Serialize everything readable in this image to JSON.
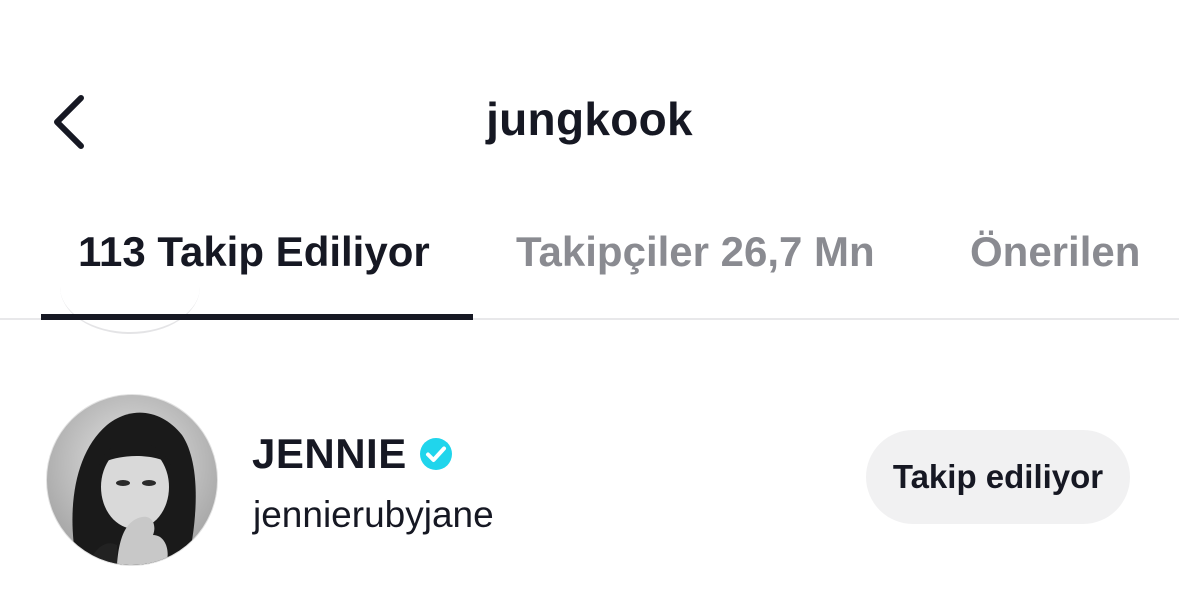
{
  "header": {
    "title": "jungkook",
    "back_icon": "chevron-left-icon"
  },
  "tabs": [
    {
      "label": "113 Takip Ediliyor",
      "active": true
    },
    {
      "label": "Takipçiler 26,7 Mn",
      "active": false
    },
    {
      "label": "Önerilen",
      "active": false
    }
  ],
  "users": [
    {
      "display_name": "JENNIE",
      "verified": true,
      "username": "jennierubyjane",
      "action_label": "Takip ediliyor",
      "avatar_icon": "avatar-photo"
    }
  ],
  "colors": {
    "text_primary": "#161823",
    "text_secondary": "#8a8b91",
    "verified_badge": "#20d5ec",
    "button_bg": "#f1f1f2",
    "divider": "#e8e8ea"
  }
}
